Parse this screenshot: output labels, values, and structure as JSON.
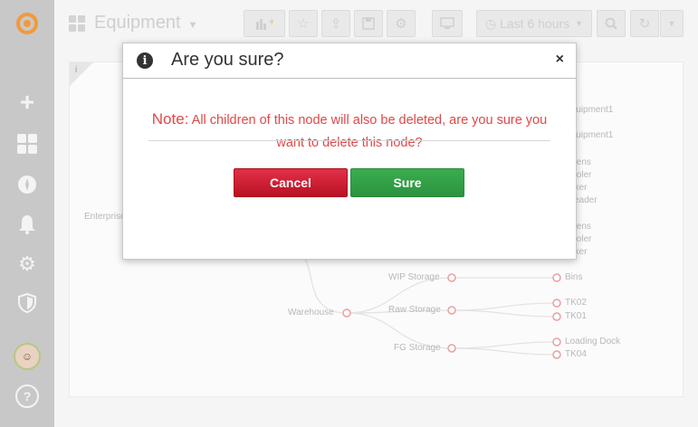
{
  "sidebar": {
    "icons": [
      "grafana-logo-icon",
      "plus-icon",
      "dashboard-icon",
      "explore-icon",
      "bell-icon",
      "gear-icon",
      "shield-icon",
      "avatar",
      "help-icon"
    ],
    "help_glyph": "?"
  },
  "topbar": {
    "dashboard_title": "Equipment",
    "time_range": "Last 6 hours"
  },
  "panel": {
    "info_glyph": "i",
    "root_label": "Enterprise",
    "right_labels": [
      "Equipment1",
      "Equipment1",
      "Ovens",
      "Cooler",
      "Mixer",
      "Breader",
      "Ovens",
      "Cooler",
      "Mixer"
    ],
    "warehouse": {
      "label": "Warehouse",
      "children": [
        {
          "label": "WIP Storage",
          "leaves": [
            "Bins"
          ]
        },
        {
          "label": "Raw Storage",
          "leaves": [
            "TK02",
            "TK01"
          ]
        },
        {
          "label": "FG Storage",
          "leaves": [
            "Loading Dock",
            "TK04"
          ]
        }
      ]
    },
    "node_color": "#e8a0a0"
  },
  "modal": {
    "title": "Are you sure?",
    "close_glyph": "×",
    "note_label": "Note:",
    "message": "All children of this node will also be deleted, are you sure you want to delete this node?",
    "cancel_label": "Cancel",
    "sure_label": "Sure",
    "cancel_color": "#c91a2e",
    "sure_color": "#32a046"
  }
}
